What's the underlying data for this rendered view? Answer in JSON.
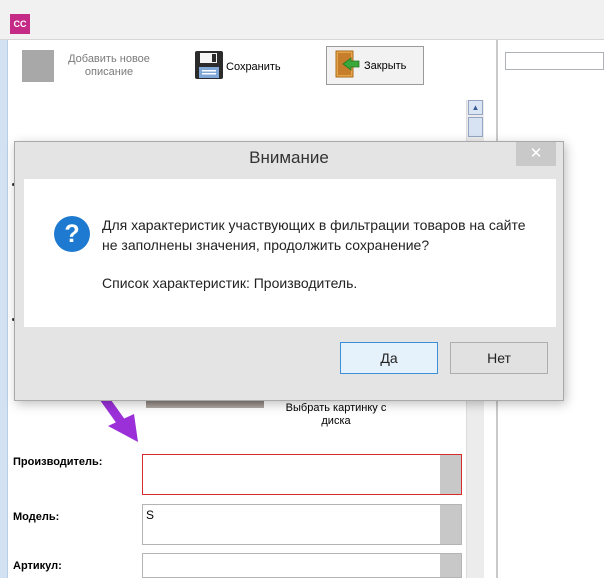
{
  "window": {
    "app_icon_text": "CC"
  },
  "toolbar": {
    "add_description_label": "Добавить новое описание",
    "save_label": "Сохранить",
    "close_label": "Закрыть"
  },
  "image_picker": {
    "label": "Выбрать картинку с диска"
  },
  "form": {
    "manufacturer_label": "Производитель:",
    "manufacturer_value": "",
    "model_label": "Модель:",
    "model_value": "S",
    "article_label": "Артикул:",
    "article_value": ""
  },
  "dialog": {
    "title": "Внимание",
    "close_glyph": "✕",
    "icon_glyph": "?",
    "message": "Для характеристик участвующих в фильтрации товаров на сайте не заполнены значения, продолжить сохранение?",
    "characteristics_list": "Список характеристик: Производитель.",
    "yes_label": "Да",
    "no_label": "Нет"
  },
  "colors": {
    "app_icon": "#c42a86",
    "info_icon": "#1e7ad0",
    "invalid_field_border": "#d52b2b",
    "annotation_arrow": "#9b30d9"
  },
  "icons": [
    "floppy-disk-icon",
    "door-exit-icon",
    "question-icon",
    "close-icon",
    "scroll-up-icon"
  ]
}
